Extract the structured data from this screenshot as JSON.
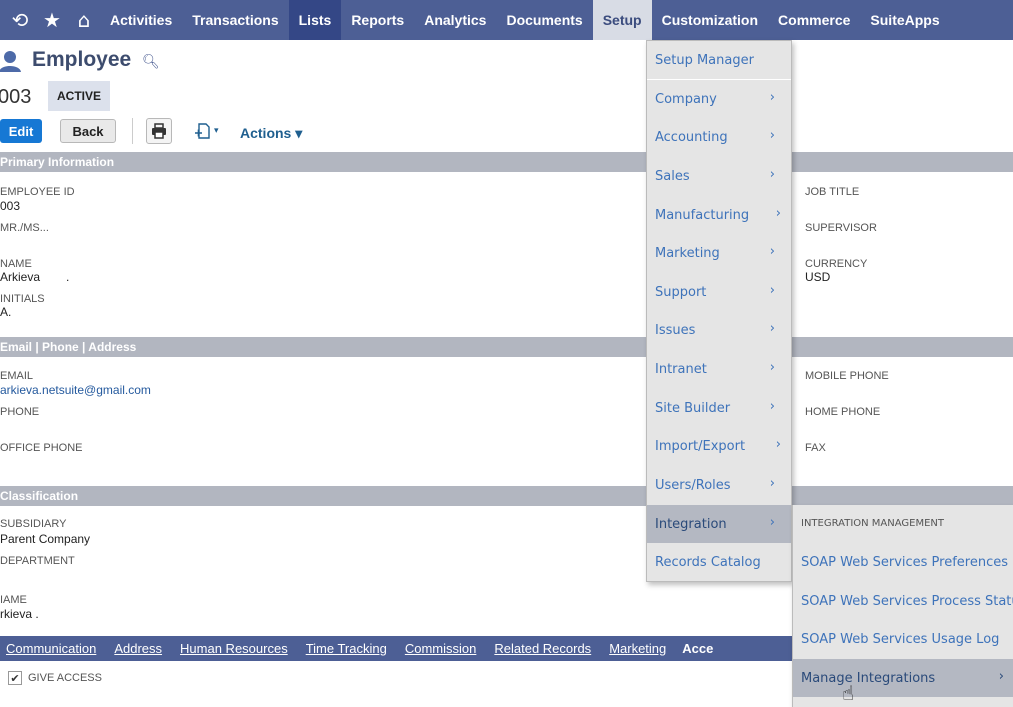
{
  "topnav": {
    "icons": [
      "recent-icon",
      "star-icon",
      "home-icon"
    ],
    "items": [
      "Activities",
      "Transactions",
      "Lists",
      "Reports",
      "Analytics",
      "Documents",
      "Setup",
      "Customization",
      "Commerce",
      "SuiteApps"
    ]
  },
  "record": {
    "title": "Employee",
    "number": "003",
    "status": "ACTIVE"
  },
  "buttons": {
    "edit": "Edit",
    "back": "Back",
    "actions": "Actions ▾"
  },
  "sections": {
    "primary": "Primary Information",
    "email": "Email | Phone | Address",
    "classification": "Classification"
  },
  "fields": {
    "employee_id_label": "EMPLOYEE ID",
    "employee_id_value": "003",
    "mrms_label": "MR./MS...",
    "name_label": "NAME",
    "name_value": "Arkieva",
    "name_dot": ".",
    "initials_label": "INITIALS",
    "initials_value": "A.",
    "job_title_label": "JOB TITLE",
    "supervisor_label": "SUPERVISOR",
    "currency_label": "CURRENCY",
    "currency_value": "USD",
    "email_label": "EMAIL",
    "email_value": "arkieva.netsuite@gmail.com",
    "phone_label": "PHONE",
    "office_phone_label": "OFFICE PHONE",
    "mobile_phone_label": "MOBILE PHONE",
    "home_phone_label": "HOME PHONE",
    "fax_label": "FAX",
    "subsidiary_label": "SUBSIDIARY",
    "subsidiary_value": "Parent Company",
    "department_label": "DEPARTMENT",
    "class_name_label": "IAME",
    "class_name_value": "rkieva ."
  },
  "subtabs": [
    "Communication",
    "Address",
    "Human Resources",
    "Time Tracking",
    "Commission",
    "Related Records",
    "Marketing",
    "Acce"
  ],
  "access": {
    "give_access": "GIVE ACCESS"
  },
  "setup_menu": {
    "items": [
      "Setup Manager",
      "Company",
      "Accounting",
      "Sales",
      "Manufacturing",
      "Marketing",
      "Support",
      "Issues",
      "Intranet",
      "Site Builder",
      "Import/Export",
      "Users/Roles",
      "Integration",
      "Records Catalog"
    ]
  },
  "integration_submenu": {
    "header": "INTEGRATION MANAGEMENT",
    "items": [
      "SOAP Web Services Preferences",
      "SOAP Web Services Process Status",
      "SOAP Web Services Usage Log",
      "Manage Integrations"
    ]
  },
  "colors": {
    "nav_bg": "#4d5f95",
    "section_bg": "#b2b6c0",
    "edit_blue": "#1678d4",
    "menu_bg": "#e5e5e5",
    "link": "#3e73ba"
  }
}
